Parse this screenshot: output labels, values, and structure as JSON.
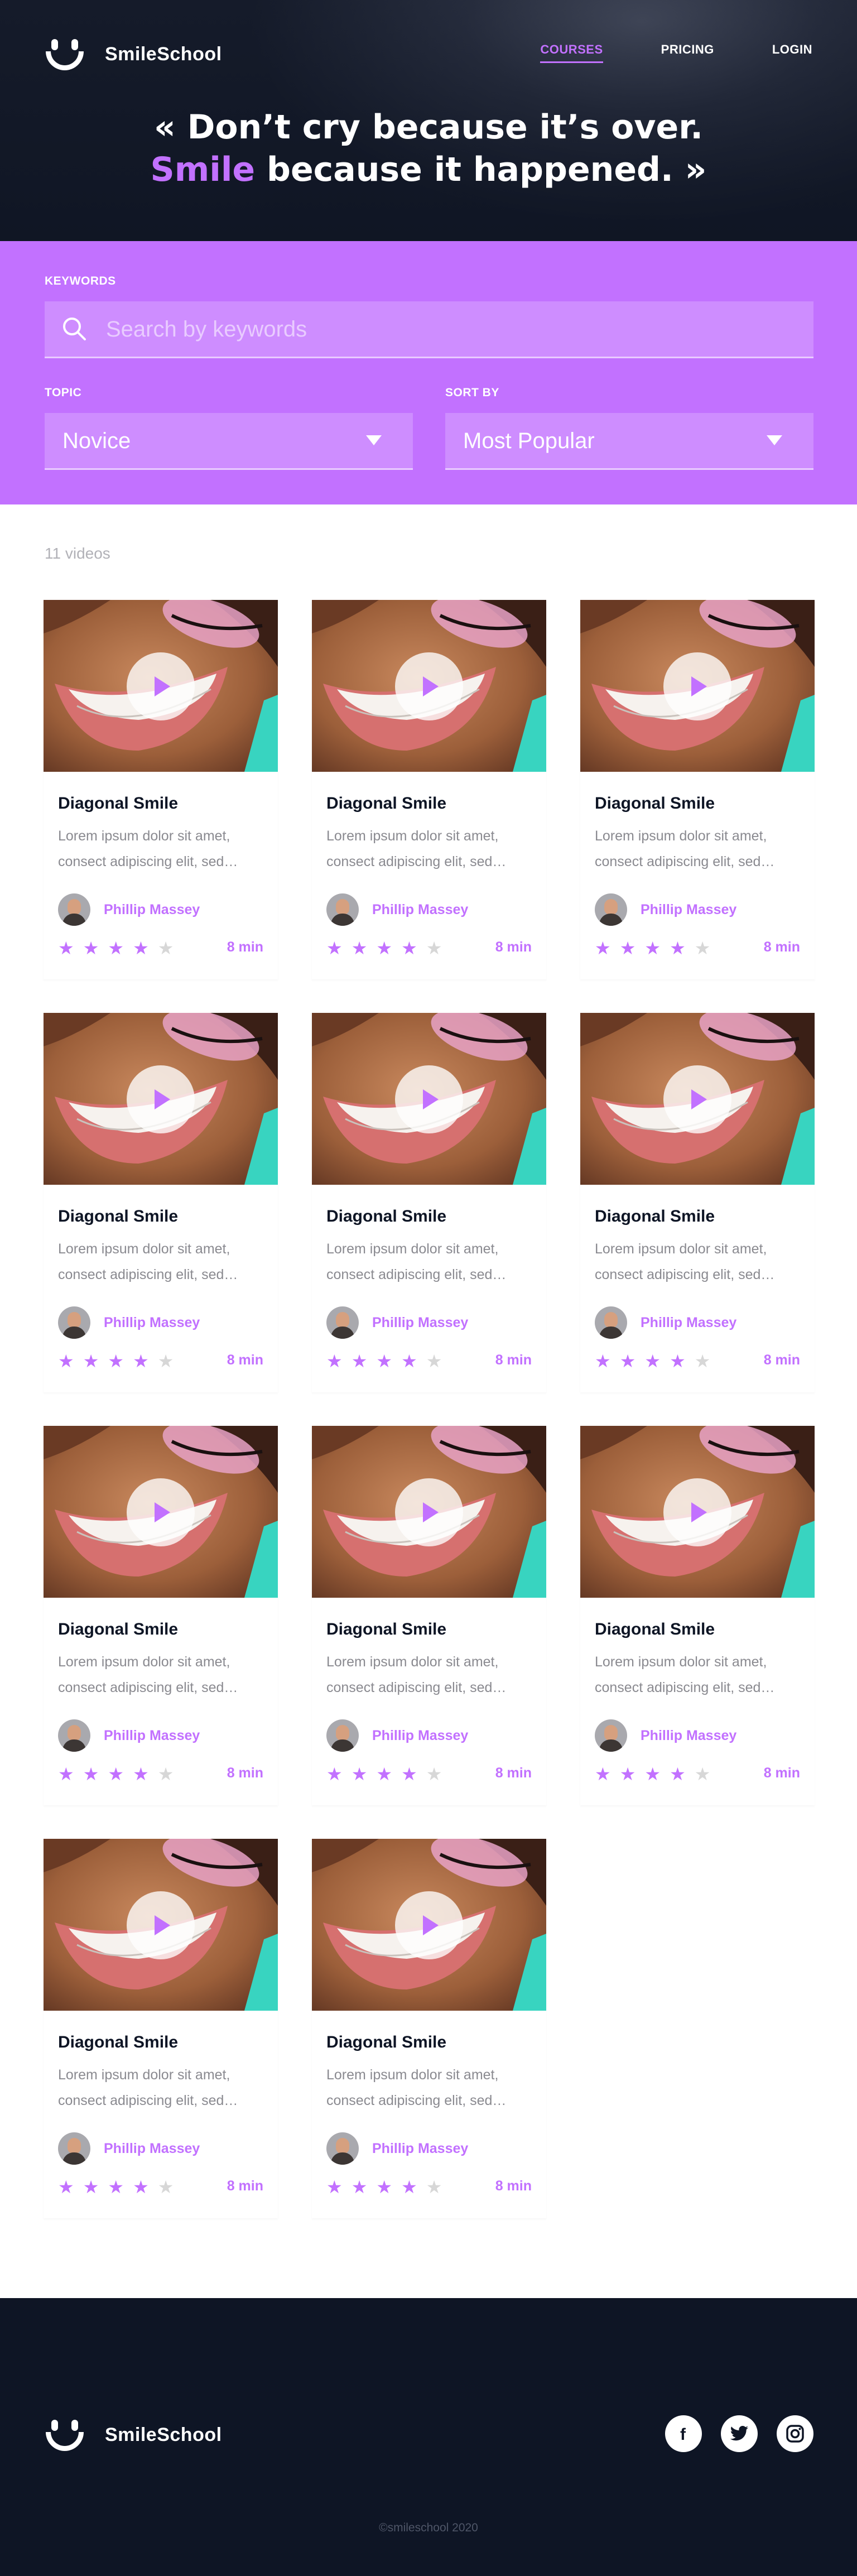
{
  "header": {
    "brand": "SmileSchool",
    "nav": [
      "COURSES",
      "PRICING",
      "LOGIN"
    ],
    "active_nav": "COURSES"
  },
  "hero": {
    "quote_line1": "« Don’t cry because it’s over.",
    "quote_highlight": "Smile",
    "quote_line2_rest": " because it happened. »"
  },
  "filters": {
    "keywords_label": "KEYWORDS",
    "search_placeholder": "Search by keywords",
    "topic_label": "TOPIC",
    "topic_value": "Novice",
    "sort_label": "SORT BY",
    "sort_value": "Most Popular"
  },
  "results": {
    "count": "11 videos",
    "cards": [
      {
        "title": "Diagonal Smile",
        "description": "Lorem ipsum dolor sit amet, consect adipiscing elit, sed…",
        "author": "Phillip Massey",
        "rating": 4,
        "duration": "8 min"
      },
      {
        "title": "Diagonal Smile",
        "description": "Lorem ipsum dolor sit amet, consect adipiscing elit, sed…",
        "author": "Phillip Massey",
        "rating": 4,
        "duration": "8 min"
      },
      {
        "title": "Diagonal Smile",
        "description": "Lorem ipsum dolor sit amet, consect adipiscing elit, sed…",
        "author": "Phillip Massey",
        "rating": 4,
        "duration": "8 min"
      },
      {
        "title": "Diagonal Smile",
        "description": "Lorem ipsum dolor sit amet, consect adipiscing elit, sed…",
        "author": "Phillip Massey",
        "rating": 4,
        "duration": "8 min"
      },
      {
        "title": "Diagonal Smile",
        "description": "Lorem ipsum dolor sit amet, consect adipiscing elit, sed…",
        "author": "Phillip Massey",
        "rating": 4,
        "duration": "8 min"
      },
      {
        "title": "Diagonal Smile",
        "description": "Lorem ipsum dolor sit amet, consect adipiscing elit, sed…",
        "author": "Phillip Massey",
        "rating": 4,
        "duration": "8 min"
      },
      {
        "title": "Diagonal Smile",
        "description": "Lorem ipsum dolor sit amet, consect adipiscing elit, sed…",
        "author": "Phillip Massey",
        "rating": 4,
        "duration": "8 min"
      },
      {
        "title": "Diagonal Smile",
        "description": "Lorem ipsum dolor sit amet, consect adipiscing elit, sed…",
        "author": "Phillip Massey",
        "rating": 4,
        "duration": "8 min"
      },
      {
        "title": "Diagonal Smile",
        "description": "Lorem ipsum dolor sit amet, consect adipiscing elit, sed…",
        "author": "Phillip Massey",
        "rating": 4,
        "duration": "8 min"
      },
      {
        "title": "Diagonal Smile",
        "description": "Lorem ipsum dolor sit amet, consect adipiscing elit, sed…",
        "author": "Phillip Massey",
        "rating": 4,
        "duration": "8 min"
      },
      {
        "title": "Diagonal Smile",
        "description": "Lorem ipsum dolor sit amet, consect adipiscing elit, sed…",
        "author": "Phillip Massey",
        "rating": 4,
        "duration": "8 min"
      }
    ]
  },
  "footer": {
    "brand": "SmileSchool",
    "social": [
      "facebook-icon",
      "twitter-icon",
      "instagram-icon"
    ],
    "copyright": "©smileschool 2020"
  },
  "colors": {
    "accent": "#c271ff",
    "dark": "#0e1525",
    "muted_text": "#8a8a90",
    "star_off": "#d7d7d7"
  }
}
